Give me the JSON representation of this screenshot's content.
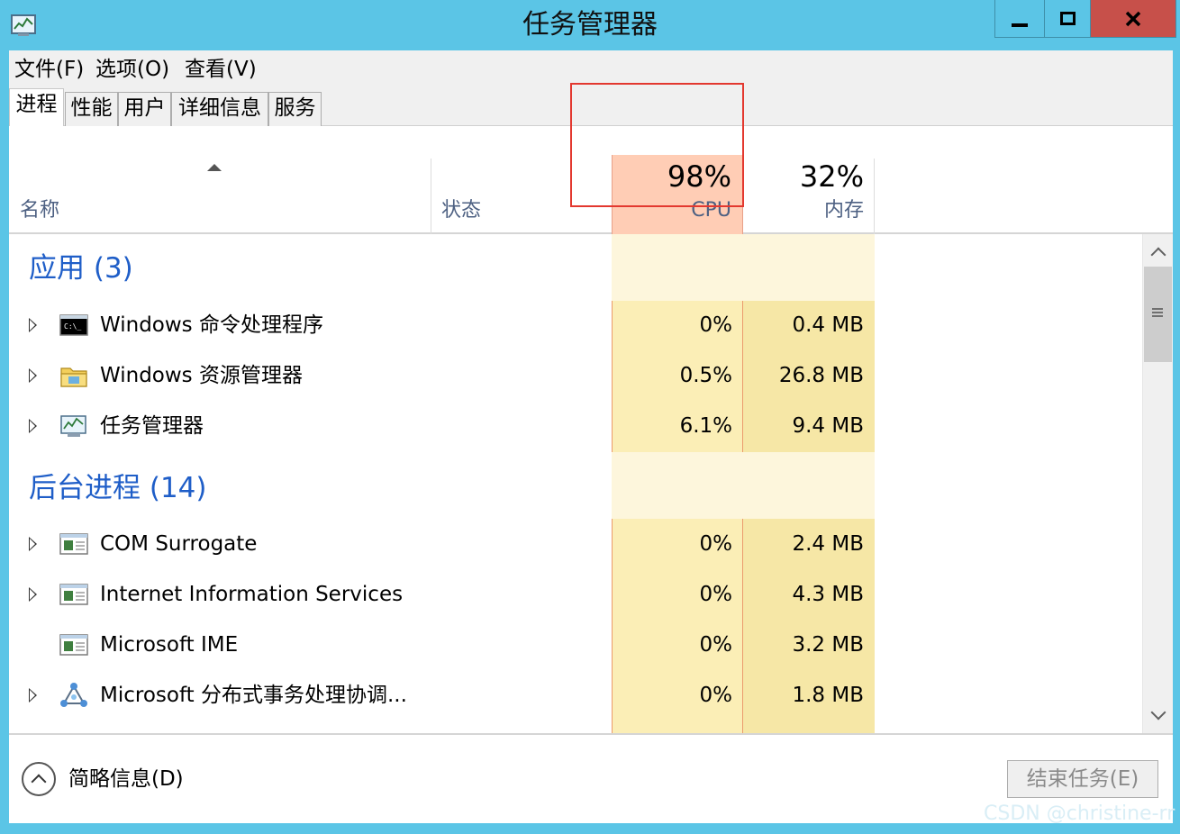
{
  "window": {
    "title": "任务管理器"
  },
  "menu": {
    "file": "文件(F)",
    "options": "选项(O)",
    "view": "查看(V)"
  },
  "tabs": {
    "processes": "进程",
    "performance": "性能",
    "users": "用户",
    "details": "详细信息",
    "services": "服务"
  },
  "columns": {
    "name": "名称",
    "status": "状态",
    "cpu_percent": "98%",
    "cpu_label": "CPU",
    "memory_percent": "32%",
    "memory_label": "内存"
  },
  "groups": {
    "apps": {
      "title": "应用 (3)",
      "rows": [
        {
          "name": "Windows 命令处理程序",
          "cpu": "0%",
          "memory": "0.4 MB",
          "icon": "cmd-icon"
        },
        {
          "name": "Windows 资源管理器",
          "cpu": "0.5%",
          "memory": "26.8 MB",
          "icon": "folder-icon"
        },
        {
          "name": "任务管理器",
          "cpu": "6.1%",
          "memory": "9.4 MB",
          "icon": "task-manager-icon"
        }
      ]
    },
    "background": {
      "title": "后台进程 (14)",
      "rows": [
        {
          "name": "COM Surrogate",
          "cpu": "0%",
          "memory": "2.4 MB",
          "icon": "window-app-icon"
        },
        {
          "name": "Internet Information Services",
          "cpu": "0%",
          "memory": "4.3 MB",
          "icon": "window-app-icon"
        },
        {
          "name": "Microsoft IME",
          "cpu": "0%",
          "memory": "3.2 MB",
          "icon": "window-app-icon"
        },
        {
          "name": "Microsoft 分布式事务处理协调...",
          "cpu": "0%",
          "memory": "1.8 MB",
          "icon": "network-nodes-icon"
        }
      ]
    }
  },
  "footer": {
    "fewer_details": "简略信息(D)",
    "end_task": "结束任务(E)"
  },
  "watermark": "CSDN @christine-rr",
  "colors": {
    "titlebar": "#5bc5e6",
    "close_button": "#c7504a",
    "cpu_header": "#ffcdb5",
    "cpu_column": "#fbeeb6",
    "memory_column": "#f6e7a6",
    "group_title": "#1f5ec8",
    "highlight_border": "#e3382f"
  }
}
